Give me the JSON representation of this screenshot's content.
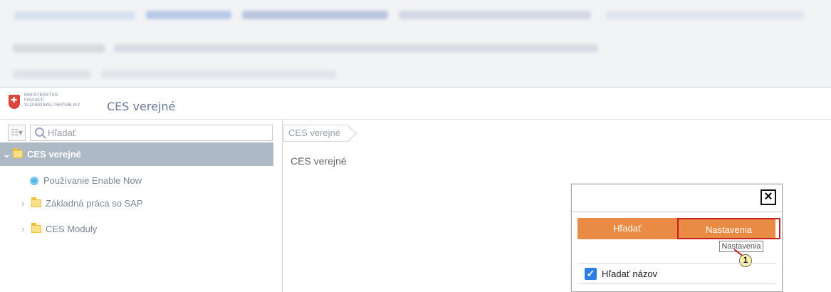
{
  "logo": {
    "line1": "MINISTERSTVO",
    "line2": "FINANCIÍ",
    "line3": "SLOVENSKEJ REPUBLIKY"
  },
  "app": {
    "title": "CES verejné"
  },
  "sidebar": {
    "search_placeholder": "Hľadať",
    "items": [
      {
        "label": "CES verejné"
      },
      {
        "label": "Používanie Enable Now"
      },
      {
        "label": "Základná práca so SAP"
      },
      {
        "label": "CES Moduly"
      }
    ]
  },
  "main": {
    "breadcrumb": "CES verejné",
    "title": "CES verejné"
  },
  "dialog": {
    "close_label": "×",
    "tabs": [
      {
        "label": "Hľadať"
      },
      {
        "label": "Nastavenia"
      }
    ],
    "tooltip": "Nastavenia",
    "step": "1",
    "option_label": "Hľadať názov"
  }
}
